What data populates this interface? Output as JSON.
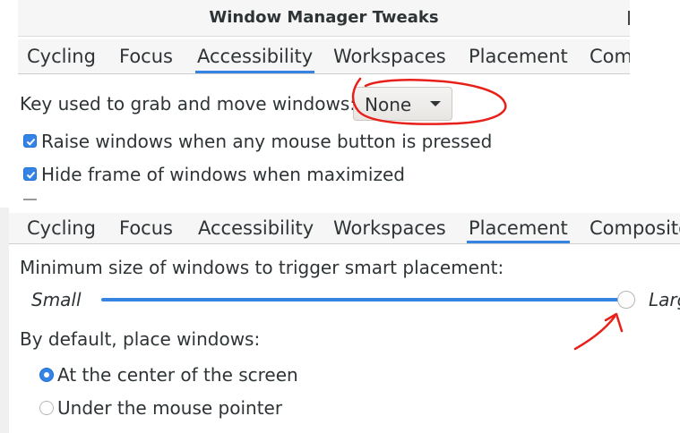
{
  "window": {
    "title": "Window Manager Tweaks"
  },
  "tabs_top": {
    "items": [
      "Cycling",
      "Focus",
      "Accessibility",
      "Workspaces",
      "Placement",
      "Com"
    ],
    "active": "Accessibility"
  },
  "accessibility": {
    "grab_key_label": "Key used to grab and move windows:",
    "grab_key_value": "None",
    "raise_windows_label": "Raise windows when any mouse button is pressed",
    "raise_windows_checked": true,
    "hide_frame_label": "Hide frame of windows when maximized",
    "hide_frame_checked": true
  },
  "tabs_bottom": {
    "items": [
      "Cycling",
      "Focus",
      "Accessibility",
      "Workspaces",
      "Placement",
      "Composito"
    ],
    "active": "Placement"
  },
  "placement": {
    "min_size_label": "Minimum size of windows to trigger smart placement:",
    "slider_min_label": "Small",
    "slider_max_label": "Larg",
    "slider_value_fraction": 1.0,
    "default_place_label": "By default, place windows:",
    "options": [
      {
        "label": "At the center of the screen",
        "selected": true
      },
      {
        "label": "Under the mouse pointer",
        "selected": false
      }
    ]
  },
  "colors": {
    "accent": "#3584e4",
    "annotation": "#e8201a"
  }
}
